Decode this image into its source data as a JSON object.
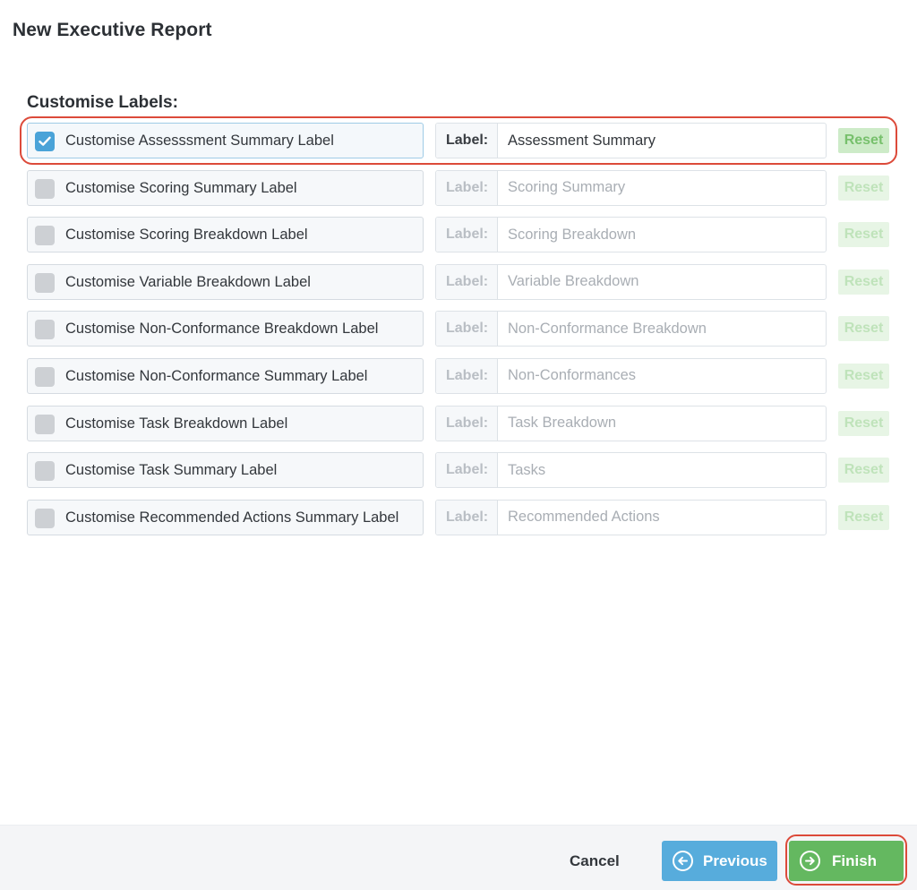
{
  "page": {
    "title": "New Executive Report"
  },
  "section": {
    "title": "Customise Labels:"
  },
  "colors": {
    "checkbox_checked": "#4aa3d8",
    "reset_green": "#77c06c",
    "previous_blue": "#57acdc",
    "finish_green": "#64b860",
    "highlight_red": "#dc4a3a"
  },
  "rows": [
    {
      "toggle_label": "Customise Assesssment Summary Label",
      "checked": true,
      "prefix": "Label:",
      "value": "Assessment Summary",
      "reset_label": "Reset"
    },
    {
      "toggle_label": "Customise Scoring Summary Label",
      "checked": false,
      "prefix": "Label:",
      "value": "Scoring Summary",
      "reset_label": "Reset"
    },
    {
      "toggle_label": "Customise Scoring Breakdown Label",
      "checked": false,
      "prefix": "Label:",
      "value": "Scoring Breakdown",
      "reset_label": "Reset"
    },
    {
      "toggle_label": "Customise Variable Breakdown Label",
      "checked": false,
      "prefix": "Label:",
      "value": "Variable Breakdown",
      "reset_label": "Reset"
    },
    {
      "toggle_label": "Customise Non-Conformance Breakdown Label",
      "checked": false,
      "prefix": "Label:",
      "value": "Non-Conformance Breakdown",
      "reset_label": "Reset"
    },
    {
      "toggle_label": "Customise Non-Conformance Summary Label",
      "checked": false,
      "prefix": "Label:",
      "value": "Non-Conformances",
      "reset_label": "Reset"
    },
    {
      "toggle_label": "Customise Task Breakdown Label",
      "checked": false,
      "prefix": "Label:",
      "value": "Task Breakdown",
      "reset_label": "Reset"
    },
    {
      "toggle_label": "Customise Task Summary Label",
      "checked": false,
      "prefix": "Label:",
      "value": "Tasks",
      "reset_label": "Reset"
    },
    {
      "toggle_label": "Customise Recommended Actions Summary Label",
      "checked": false,
      "prefix": "Label:",
      "value": "Recommended Actions",
      "reset_label": "Reset"
    }
  ],
  "footer": {
    "cancel_label": "Cancel",
    "previous_label": "Previous",
    "previous_icon": "arrow-left-circle-icon",
    "finish_label": "Finish",
    "finish_icon": "arrow-right-circle-icon"
  }
}
